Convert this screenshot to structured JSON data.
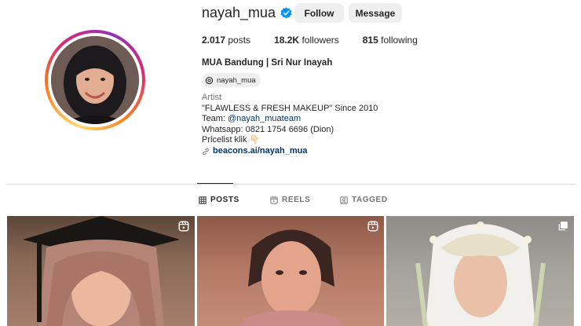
{
  "profile": {
    "username": "nayah_mua",
    "verified_icon": "verified-badge-icon",
    "follow_label": "Follow",
    "message_label": "Message",
    "stats": {
      "posts_count": "2.017",
      "posts_label": "posts",
      "followers_count": "18.2K",
      "followers_label": "followers",
      "following_count": "815",
      "following_label": "following"
    },
    "full_name": "MUA Bandung | Sri Nur Inayah",
    "threads_handle": "nayah_mua",
    "bio": {
      "category": "Artist",
      "line1": "\"FLAWLESS & FRESH MAKEUP\" Since 2010",
      "team_label": "Team: ",
      "team_link": "@nayah_muateam",
      "whatsapp": "Whatsapp: 0821 1754 6696 (Dion)",
      "pricelist": "Pricelist klik",
      "pricelist_emoji": "👇🏻",
      "external_link": "beacons.ai/nayah_mua"
    }
  },
  "tabs": [
    {
      "label": "POSTS",
      "icon": "grid-icon",
      "active": true
    },
    {
      "label": "REELS",
      "icon": "reels-icon",
      "active": false
    },
    {
      "label": "TAGGED",
      "icon": "tagged-icon",
      "active": false
    }
  ],
  "posts": [
    {
      "type_icon": "reel-icon"
    },
    {
      "type_icon": "reel-icon"
    },
    {
      "type_icon": "carousel-icon"
    }
  ],
  "colors": {
    "link": "#00376b",
    "verified": "#0095f6",
    "button_bg": "#efefef",
    "text": "#262626",
    "muted": "#737373"
  }
}
